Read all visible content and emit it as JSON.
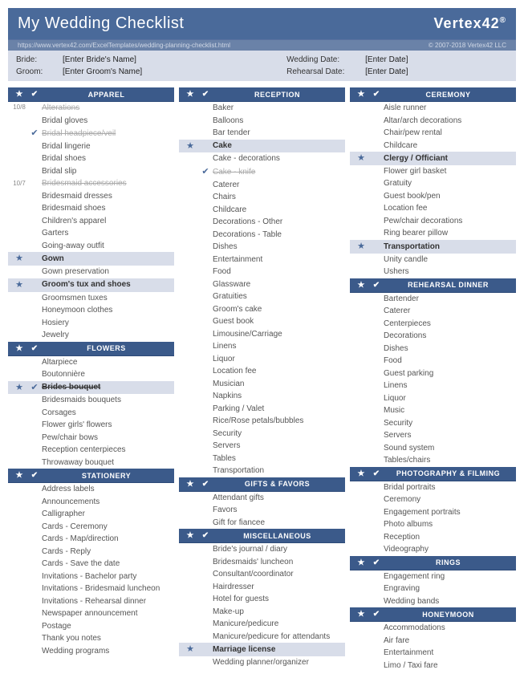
{
  "header": {
    "title": "My Wedding Checklist",
    "logo_prefix": "Vertex",
    "logo_suffix": "42",
    "url": "https://www.vertex42.com/ExcelTemplates/wedding-planning-checklist.html",
    "copyright": "© 2007-2018 Vertex42 LLC"
  },
  "info": {
    "bride_label": "Bride:",
    "bride_val": "[Enter Bride's Name]",
    "groom_label": "Groom:",
    "groom_val": "[Enter Groom's Name]",
    "wed_label": "Wedding Date:",
    "wed_val": "[Enter Date]",
    "reh_label": "Rehearsal Date:",
    "reh_val": "[Enter Date]"
  },
  "columns": [
    {
      "sections": [
        {
          "title": "APPAREL",
          "items": [
            {
              "t": "Alterations",
              "star": "10/8",
              "pri": true,
              "done": true
            },
            {
              "t": "Bridal gloves"
            },
            {
              "t": "Bridal headpiece/veil",
              "check": true,
              "done": true
            },
            {
              "t": "Bridal lingerie"
            },
            {
              "t": "Bridal shoes"
            },
            {
              "t": "Bridal slip"
            },
            {
              "t": "Bridesmaid accessories",
              "star": "10/7",
              "pri": true,
              "done": true
            },
            {
              "t": "Bridesmaid dresses"
            },
            {
              "t": "Bridesmaid shoes"
            },
            {
              "t": "Children's apparel"
            },
            {
              "t": "Garters"
            },
            {
              "t": "Going-away outfit"
            },
            {
              "t": "Gown",
              "star": "★",
              "shade": true
            },
            {
              "t": "Gown preservation"
            },
            {
              "t": "Groom's tux and shoes",
              "star": "★",
              "shade": true
            },
            {
              "t": "Groomsmen tuxes"
            },
            {
              "t": "Honeymoon clothes"
            },
            {
              "t": "Hosiery"
            },
            {
              "t": "Jewelry"
            }
          ]
        },
        {
          "title": "FLOWERS",
          "items": [
            {
              "t": "Altarpiece"
            },
            {
              "t": "Boutonnière"
            },
            {
              "t": "Brides bouquet",
              "star": "★",
              "check": true,
              "shade": true,
              "done": true
            },
            {
              "t": "Bridesmaids bouquets"
            },
            {
              "t": "Corsages"
            },
            {
              "t": "Flower girls' flowers"
            },
            {
              "t": "Pew/chair bows"
            },
            {
              "t": "Reception centerpieces"
            },
            {
              "t": "Throwaway bouquet"
            }
          ]
        },
        {
          "title": "STATIONERY",
          "items": [
            {
              "t": "Address labels"
            },
            {
              "t": "Announcements"
            },
            {
              "t": "Calligrapher"
            },
            {
              "t": "Cards - Ceremony"
            },
            {
              "t": "Cards - Map/direction"
            },
            {
              "t": "Cards - Reply"
            },
            {
              "t": "Cards - Save the date"
            },
            {
              "t": "Invitations - Bachelor party"
            },
            {
              "t": "Invitations - Bridesmaid luncheon"
            },
            {
              "t": "Invitations - Rehearsal dinner"
            },
            {
              "t": "Newspaper announcement"
            },
            {
              "t": "Postage"
            },
            {
              "t": "Thank you notes"
            },
            {
              "t": "Wedding programs"
            }
          ]
        }
      ]
    },
    {
      "sections": [
        {
          "title": "RECEPTION",
          "items": [
            {
              "t": "Baker"
            },
            {
              "t": "Balloons"
            },
            {
              "t": "Bar tender"
            },
            {
              "t": "Cake",
              "star": "★",
              "shade": true
            },
            {
              "t": "Cake - decorations"
            },
            {
              "t": "Cake - knife",
              "check": true,
              "done": true
            },
            {
              "t": "Caterer"
            },
            {
              "t": "Chairs"
            },
            {
              "t": "Childcare"
            },
            {
              "t": "Decorations - Other"
            },
            {
              "t": "Decorations - Table"
            },
            {
              "t": "Dishes"
            },
            {
              "t": "Entertainment"
            },
            {
              "t": "Food"
            },
            {
              "t": "Glassware"
            },
            {
              "t": "Gratuities"
            },
            {
              "t": "Groom's cake"
            },
            {
              "t": "Guest book"
            },
            {
              "t": "Limousine/Carriage"
            },
            {
              "t": "Linens"
            },
            {
              "t": "Liquor"
            },
            {
              "t": "Location fee"
            },
            {
              "t": "Musician"
            },
            {
              "t": "Napkins"
            },
            {
              "t": "Parking / Valet"
            },
            {
              "t": "Rice/Rose petals/bubbles"
            },
            {
              "t": "Security"
            },
            {
              "t": "Servers"
            },
            {
              "t": "Tables"
            },
            {
              "t": "Transportation"
            }
          ]
        },
        {
          "title": "GIFTS & FAVORS",
          "items": [
            {
              "t": "Attendant gifts"
            },
            {
              "t": "Favors"
            },
            {
              "t": "Gift for fiancee"
            }
          ]
        },
        {
          "title": "MISCELLANEOUS",
          "items": [
            {
              "t": "Bride's journal / diary"
            },
            {
              "t": "Bridesmaids' luncheon"
            },
            {
              "t": "Consultant/coordinator"
            },
            {
              "t": "Hairdresser"
            },
            {
              "t": "Hotel for guests"
            },
            {
              "t": "Make-up"
            },
            {
              "t": "Manicure/pedicure"
            },
            {
              "t": "Manicure/pedicure for attendants"
            },
            {
              "t": "Marriage license",
              "star": "★",
              "shade": true
            },
            {
              "t": "Wedding planner/organizer"
            }
          ]
        }
      ]
    },
    {
      "sections": [
        {
          "title": "CEREMONY",
          "items": [
            {
              "t": "Aisle runner"
            },
            {
              "t": "Altar/arch decorations"
            },
            {
              "t": "Chair/pew rental"
            },
            {
              "t": "Childcare"
            },
            {
              "t": "Clergy / Officiant",
              "star": "★",
              "shade": true
            },
            {
              "t": "Flower girl basket"
            },
            {
              "t": "Gratuity"
            },
            {
              "t": "Guest book/pen"
            },
            {
              "t": "Location fee"
            },
            {
              "t": "Pew/chair decorations"
            },
            {
              "t": "Ring bearer pillow"
            },
            {
              "t": "Transportation",
              "star": "★",
              "shade": true
            },
            {
              "t": "Unity candle"
            },
            {
              "t": "Ushers"
            }
          ]
        },
        {
          "title": "REHEARSAL DINNER",
          "items": [
            {
              "t": "Bartender"
            },
            {
              "t": "Caterer"
            },
            {
              "t": "Centerpieces"
            },
            {
              "t": "Decorations"
            },
            {
              "t": "Dishes"
            },
            {
              "t": "Food"
            },
            {
              "t": "Guest parking"
            },
            {
              "t": "Linens"
            },
            {
              "t": "Liquor"
            },
            {
              "t": "Music"
            },
            {
              "t": "Security"
            },
            {
              "t": "Servers"
            },
            {
              "t": "Sound system"
            },
            {
              "t": "Tables/chairs"
            }
          ]
        },
        {
          "title": "PHOTOGRAPHY & FILMING",
          "items": [
            {
              "t": "Bridal portraits"
            },
            {
              "t": "Ceremony"
            },
            {
              "t": "Engagement portraits"
            },
            {
              "t": "Photo albums"
            },
            {
              "t": "Reception"
            },
            {
              "t": "Videography"
            }
          ]
        },
        {
          "title": "RINGS",
          "items": [
            {
              "t": "Engagement ring"
            },
            {
              "t": "Engraving"
            },
            {
              "t": "Wedding bands"
            }
          ]
        },
        {
          "title": "HONEYMOON",
          "items": [
            {
              "t": "Accommodations"
            },
            {
              "t": "Air fare"
            },
            {
              "t": "Entertainment"
            },
            {
              "t": "Limo / Taxi fare"
            }
          ]
        }
      ]
    }
  ]
}
